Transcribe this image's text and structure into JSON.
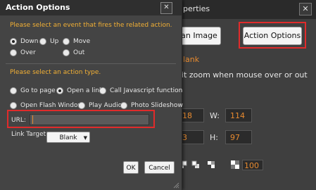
{
  "background_window": {
    "title": "perties",
    "close": "✕",
    "image_button": "an Image",
    "action_button": "Action Options",
    "link_text": "lank",
    "zoom_text": "it zoom when mouse over or out",
    "x_value": "18",
    "w_label": "W:",
    "w_value": "114",
    "y_value": "3",
    "h_label": "H:",
    "h_value": "97",
    "opacity_value": "100"
  },
  "dialog": {
    "title": "Action Options",
    "close": "✕",
    "event_prompt": "Please select an event that fires the related action.",
    "events": [
      {
        "label": "Down",
        "selected": true
      },
      {
        "label": "Up",
        "selected": false
      },
      {
        "label": "Move",
        "selected": false
      },
      {
        "label": "Over",
        "selected": false
      },
      {
        "label": "Out",
        "selected": false
      }
    ],
    "action_prompt": "Please select an action type.",
    "actions": [
      {
        "label": "Go to page",
        "selected": false
      },
      {
        "label": "Open a link",
        "selected": true
      },
      {
        "label": "Call Javascript function",
        "selected": false
      },
      {
        "label": "Open Flash Window",
        "selected": false
      },
      {
        "label": "Play Audio",
        "selected": false
      },
      {
        "label": "Photo Slideshow",
        "selected": false
      }
    ],
    "url_label": "URL:",
    "url_value": "",
    "link_target_label": "Link Target:",
    "link_target_value": "Blank",
    "ok_label": "OK",
    "cancel_label": "Cancel"
  },
  "colors": {
    "accent": "#f2b035",
    "highlight": "#e02b2b",
    "value_orange": "#e78a2f"
  }
}
